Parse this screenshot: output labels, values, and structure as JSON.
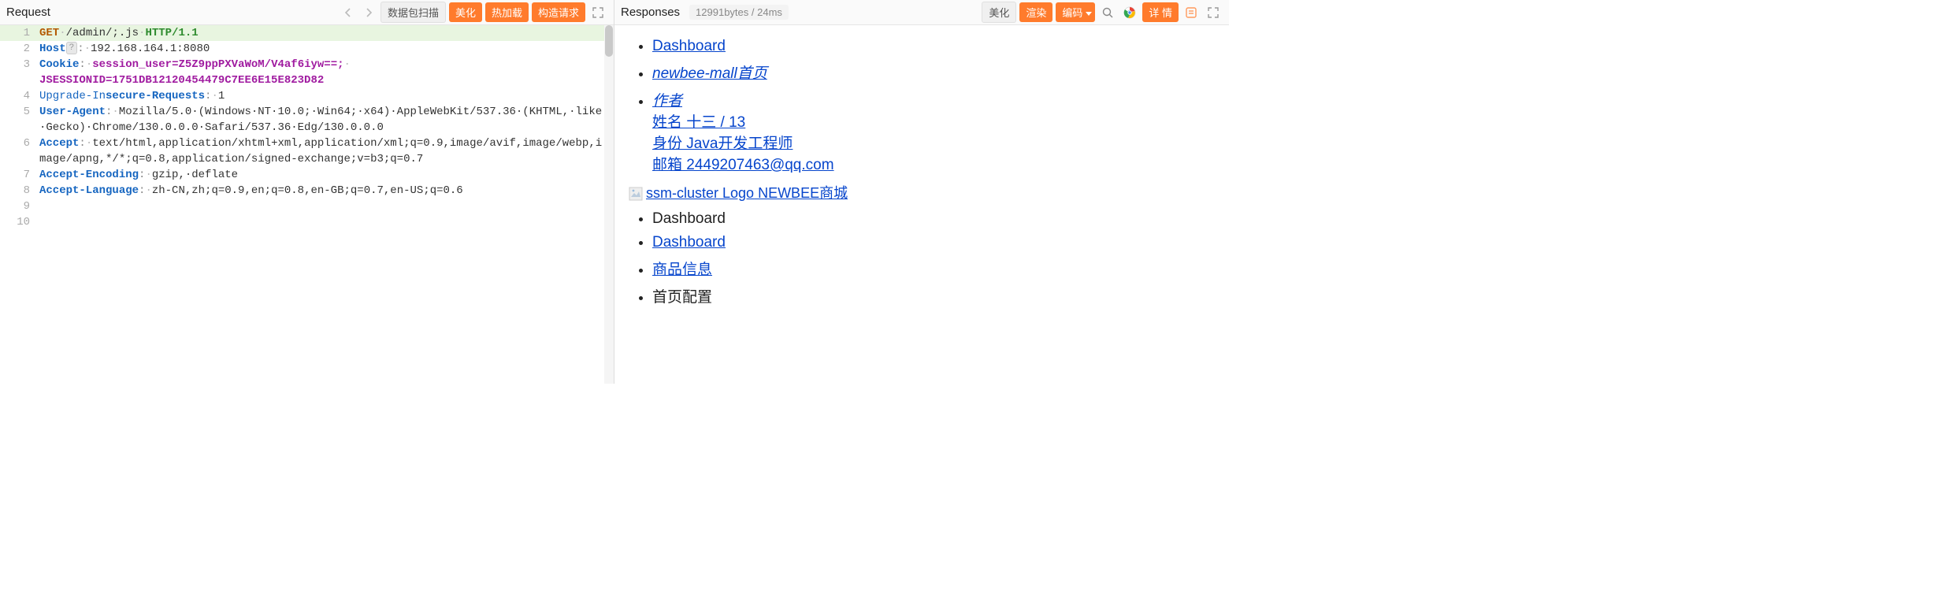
{
  "request": {
    "title": "Request",
    "scan_btn": "数据包扫描",
    "beautify_btn": "美化",
    "hotload_btn": "热加载",
    "forge_btn": "构造请求",
    "lines": {
      "l1_method": "GET",
      "l1_path": "/admin/;.js",
      "l1_proto": "HTTP/1.1",
      "l2_hdr": "Host",
      "l2_val": "192.168.164.1:8080",
      "l3_hdr": "Cookie",
      "l3_k1": "session_user",
      "l3_v1": "Z5Z9ppPXVaWoM/V4af6iyw==;",
      "l3_k2": "JSESSIONID",
      "l3_v2": "1751DB12120454479C7EE6E15E823D82",
      "l4_hdr": "Upgrade-In",
      "l4_hdr2": "secure-Requests",
      "l4_val": "1",
      "l5_hdr": "User-Agent",
      "l5_val": "Mozilla/5.0·(Windows·NT·10.0;·Win64;·x64)·AppleWebKit/537.36·(KHTML,·like·Gecko)·Chrome/130.0.0.0·Safari/537.36·Edg/130.0.0.0",
      "l6_hdr": "Accept",
      "l6_val": "text/html,application/xhtml+xml,application/xml;q=0.9,image/avif,image/webp,image/apng,*/*;q=0.8,application/signed-exchange;v=b3;q=0.7",
      "l7_hdr": "Accept-Encoding",
      "l7_val": "gzip,·deflate",
      "l8_hdr": "Accept-Language",
      "l8_val": "zh-CN,zh;q=0.9,en;q=0.8,en-GB;q=0.7,en-US;q=0.6"
    },
    "gutters": [
      "1",
      "2",
      "3",
      "4",
      "5",
      "6",
      "7",
      "8",
      "9",
      "10"
    ]
  },
  "response": {
    "title": "Responses",
    "info": "12991bytes / 24ms",
    "beautify_btn": "美化",
    "render_btn": "渲染",
    "encode_btn": "编码",
    "detail_btn": "详 情",
    "body": {
      "dashboard1": "Dashboard",
      "mall_home": "   newbee-mall首页",
      "author": "  作者",
      "name_line": "姓名 十三 / 13",
      "role_line": "身份 Java开发工程师",
      "email_line": "邮箱 2449207463@qq.com",
      "logo_alt": "ssm-cluster Logo",
      "logo_text": " NEWBEE商城",
      "dashboard2": "Dashboard",
      "dashboard3": "Dashboard",
      "product_info": "商品信息",
      "home_config": "首页配置"
    }
  }
}
